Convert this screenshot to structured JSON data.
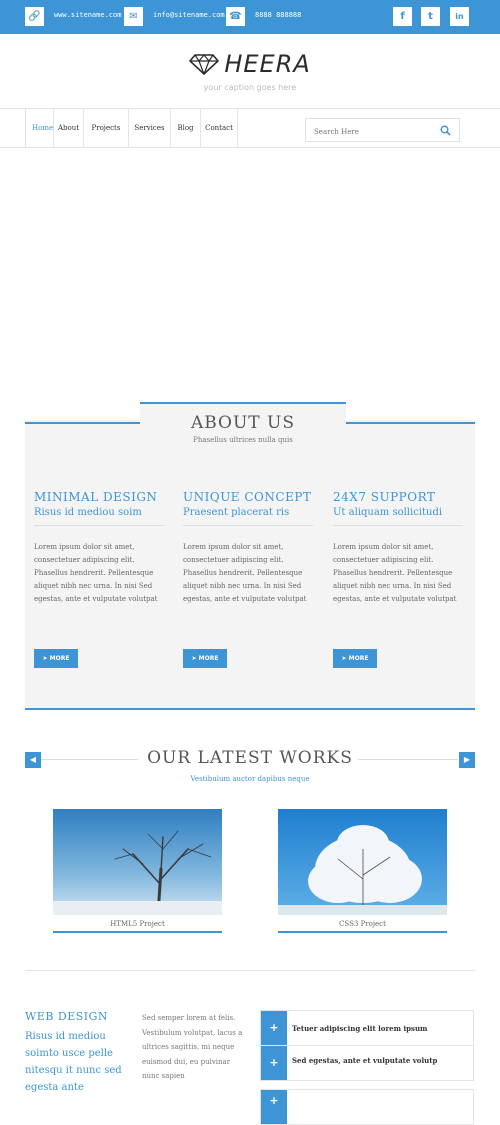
{
  "topbar": {
    "website": "www.sitename.com",
    "email": "info@sitename.com",
    "phone": "8888 888888",
    "icons": [
      "link-icon",
      "mail-icon",
      "phone-icon"
    ],
    "social": [
      "f",
      "t",
      "in"
    ]
  },
  "brand": {
    "name": "HEERA",
    "caption": "your caption goes here"
  },
  "nav": {
    "items": [
      "Home",
      "About",
      "Projects",
      "Services",
      "Blog",
      "Contact"
    ],
    "active": "Home"
  },
  "search": {
    "placeholder": "Search Here"
  },
  "about": {
    "title": "ABOUT US",
    "subtitle": "Phasellus ultrices nulla quis",
    "columns": [
      {
        "title": "MINIMAL DESIGN",
        "subtitle": "Risus id mediou soim",
        "text": "Lorem ipsum dolor sit amet, consectetuer adipiscing elit. Phasellus hendrerit. Pellentesque aliquet nibh nec urna. In nisi Sed egestas, ante et vulputate volutpat",
        "button": "MORE"
      },
      {
        "title": "UNIQUE CONCEPT",
        "subtitle": "Praesent placerat ris",
        "text": "Lorem ipsum dolor sit amet, consectetuer adipiscing elit. Phasellus hendrerit. Pellentesque aliquet nibh nec urna. In nisi Sed egestas, ante et vulputate volutpat",
        "button": "MORE"
      },
      {
        "title": "24X7 SUPPORT",
        "subtitle": "Ut aliquam sollicitudi",
        "text": "Lorem ipsum dolor sit amet, consectetuer adipiscing elit. Phasellus hendrerit. Pellentesque aliquet nibh nec urna. In nisi Sed egestas, ante et vulputate volutpat",
        "button": "MORE"
      }
    ]
  },
  "works": {
    "title": "OUR LATEST WORKS",
    "subtitle": "Vestibulum auctor dapibus neque",
    "projects": [
      {
        "label": "HTML5 Project"
      },
      {
        "label": "CSS3 Project"
      }
    ]
  },
  "webdesign": {
    "title": "WEB DESIGN",
    "text": "Risus id mediou soimto usce pelle nitesqu it nunc sed egesta ante",
    "middle": "Sed semper lorem at felis. Vestibulum volutpat, lacus a ultrices sagittis, mi neque euismod dui, eu pulvinar nunc sapien"
  },
  "features": [
    "Tetuer adipiscing elit lorem ipsum",
    "Sed egestas, ante et vulputate volutp",
    ""
  ],
  "colors": {
    "accent": "#3d95d6",
    "panel": "#f4f4f4"
  }
}
